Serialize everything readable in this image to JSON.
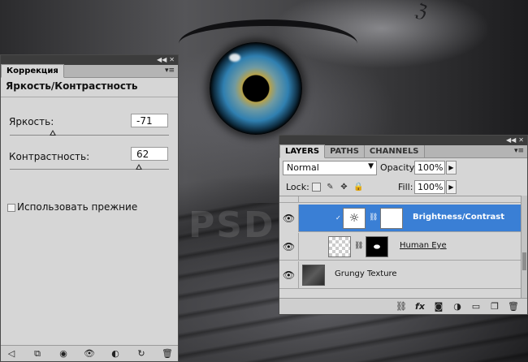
{
  "adjustments_panel": {
    "tab_label": "Коррекция",
    "title": "Яркость/Контрастность",
    "brightness": {
      "label": "Яркость:",
      "value": "-71",
      "slider_fraction": 0.27
    },
    "contrast": {
      "label": "Контрастность:",
      "value": "62",
      "slider_fraction": 0.81
    },
    "legacy_checkbox": {
      "label": "Использовать прежние",
      "checked": false
    },
    "footer_icons": [
      "back-arrow-icon",
      "clip-to-layer-icon",
      "layer-visibility-mask-icon",
      "eye-icon",
      "view-previous-state-icon",
      "reset-icon",
      "trash-icon"
    ]
  },
  "layers_panel": {
    "tabs": [
      "LAYERS",
      "PATHS",
      "CHANNELS"
    ],
    "active_tab": "LAYERS",
    "blend_mode": "Normal",
    "opacity_label": "Opacity:",
    "opacity_value": "100%",
    "lock_label": "Lock:",
    "fill_label": "Fill:",
    "fill_value": "100%",
    "layers": [
      {
        "name": "Brightness/Contrast",
        "type": "adjustment",
        "visible": true,
        "selected": true
      },
      {
        "name": "Human Eye",
        "type": "masked-image",
        "visible": true,
        "selected": false
      },
      {
        "name": "Grungy Texture",
        "type": "image",
        "visible": true,
        "selected": false
      }
    ],
    "footer_icons": [
      "link-icon",
      "fx-icon",
      "add-mask-icon",
      "new-adjustment-icon",
      "new-group-icon",
      "new-layer-icon",
      "trash-icon"
    ]
  },
  "watermark": "PSD"
}
